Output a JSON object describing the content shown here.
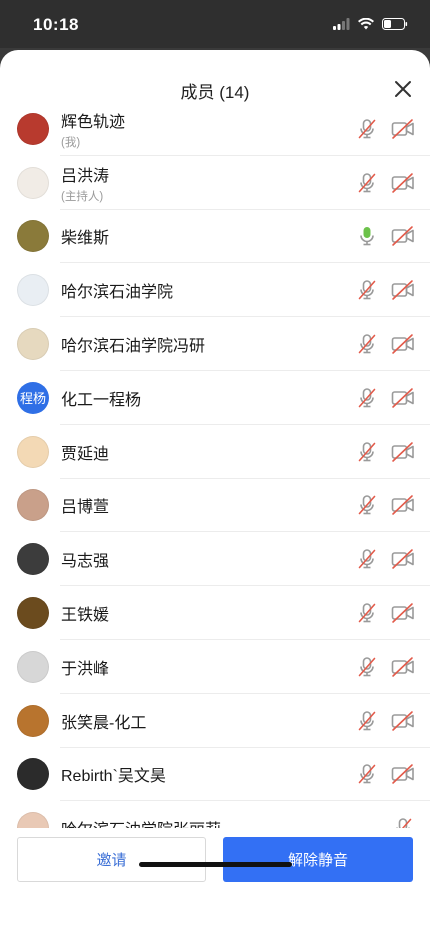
{
  "status_bar": {
    "time": "10:18"
  },
  "header": {
    "title": "成员 (14)"
  },
  "colors": {
    "accent": "#3370f4",
    "mic_on": "#6cc24a",
    "muted_red": "#e25a4a",
    "icon_grey": "#9a9a9a"
  },
  "members": [
    {
      "name": "辉色轨迹",
      "subtitle": "(我)",
      "avatar_color": "#b83a2e",
      "avatar_text": "",
      "mic_active": false,
      "cam_active": false
    },
    {
      "name": "吕洪涛",
      "subtitle": "(主持人)",
      "avatar_color": "#f1ece6",
      "avatar_text": "",
      "mic_active": false,
      "cam_active": false
    },
    {
      "name": "柴维斯",
      "subtitle": "",
      "avatar_color": "#8a7a3a",
      "avatar_text": "",
      "mic_active": true,
      "cam_active": false
    },
    {
      "name": "哈尔滨石油学院",
      "subtitle": "",
      "avatar_color": "#e9eef3",
      "avatar_text": "",
      "mic_active": false,
      "cam_active": false
    },
    {
      "name": "哈尔滨石油学院冯研",
      "subtitle": "",
      "avatar_color": "#e6d9bf",
      "avatar_text": "",
      "mic_active": false,
      "cam_active": false
    },
    {
      "name": "化工一程杨",
      "subtitle": "",
      "avatar_color": "#2f6fe6",
      "avatar_text": "程杨",
      "mic_active": false,
      "cam_active": false
    },
    {
      "name": "贾延迪",
      "subtitle": "",
      "avatar_color": "#f3d9b5",
      "avatar_text": "",
      "mic_active": false,
      "cam_active": false
    },
    {
      "name": "吕博萱",
      "subtitle": "",
      "avatar_color": "#c9a08a",
      "avatar_text": "",
      "mic_active": false,
      "cam_active": false
    },
    {
      "name": "马志强",
      "subtitle": "",
      "avatar_color": "#3c3c3c",
      "avatar_text": "",
      "mic_active": false,
      "cam_active": false
    },
    {
      "name": "王铁媛",
      "subtitle": "",
      "avatar_color": "#6b4b1e",
      "avatar_text": "",
      "mic_active": false,
      "cam_active": false
    },
    {
      "name": "于洪峰",
      "subtitle": "",
      "avatar_color": "#d7d7d7",
      "avatar_text": "",
      "mic_active": false,
      "cam_active": false
    },
    {
      "name": "张笑晨-化工",
      "subtitle": "",
      "avatar_color": "#b8742e",
      "avatar_text": "",
      "mic_active": false,
      "cam_active": false
    },
    {
      "name": "Rebirth`吴文昊",
      "subtitle": "",
      "avatar_color": "#2b2b2b",
      "avatar_text": "",
      "mic_active": false,
      "cam_active": false
    },
    {
      "name": "哈尔滨石油学院张丽莉",
      "subtitle": "",
      "avatar_color": "#e9c9b5",
      "avatar_text": "",
      "mic_active": false,
      "cam_active": false
    }
  ],
  "footer": {
    "invite_label": "邀请",
    "unmute_label": "解除静音"
  }
}
